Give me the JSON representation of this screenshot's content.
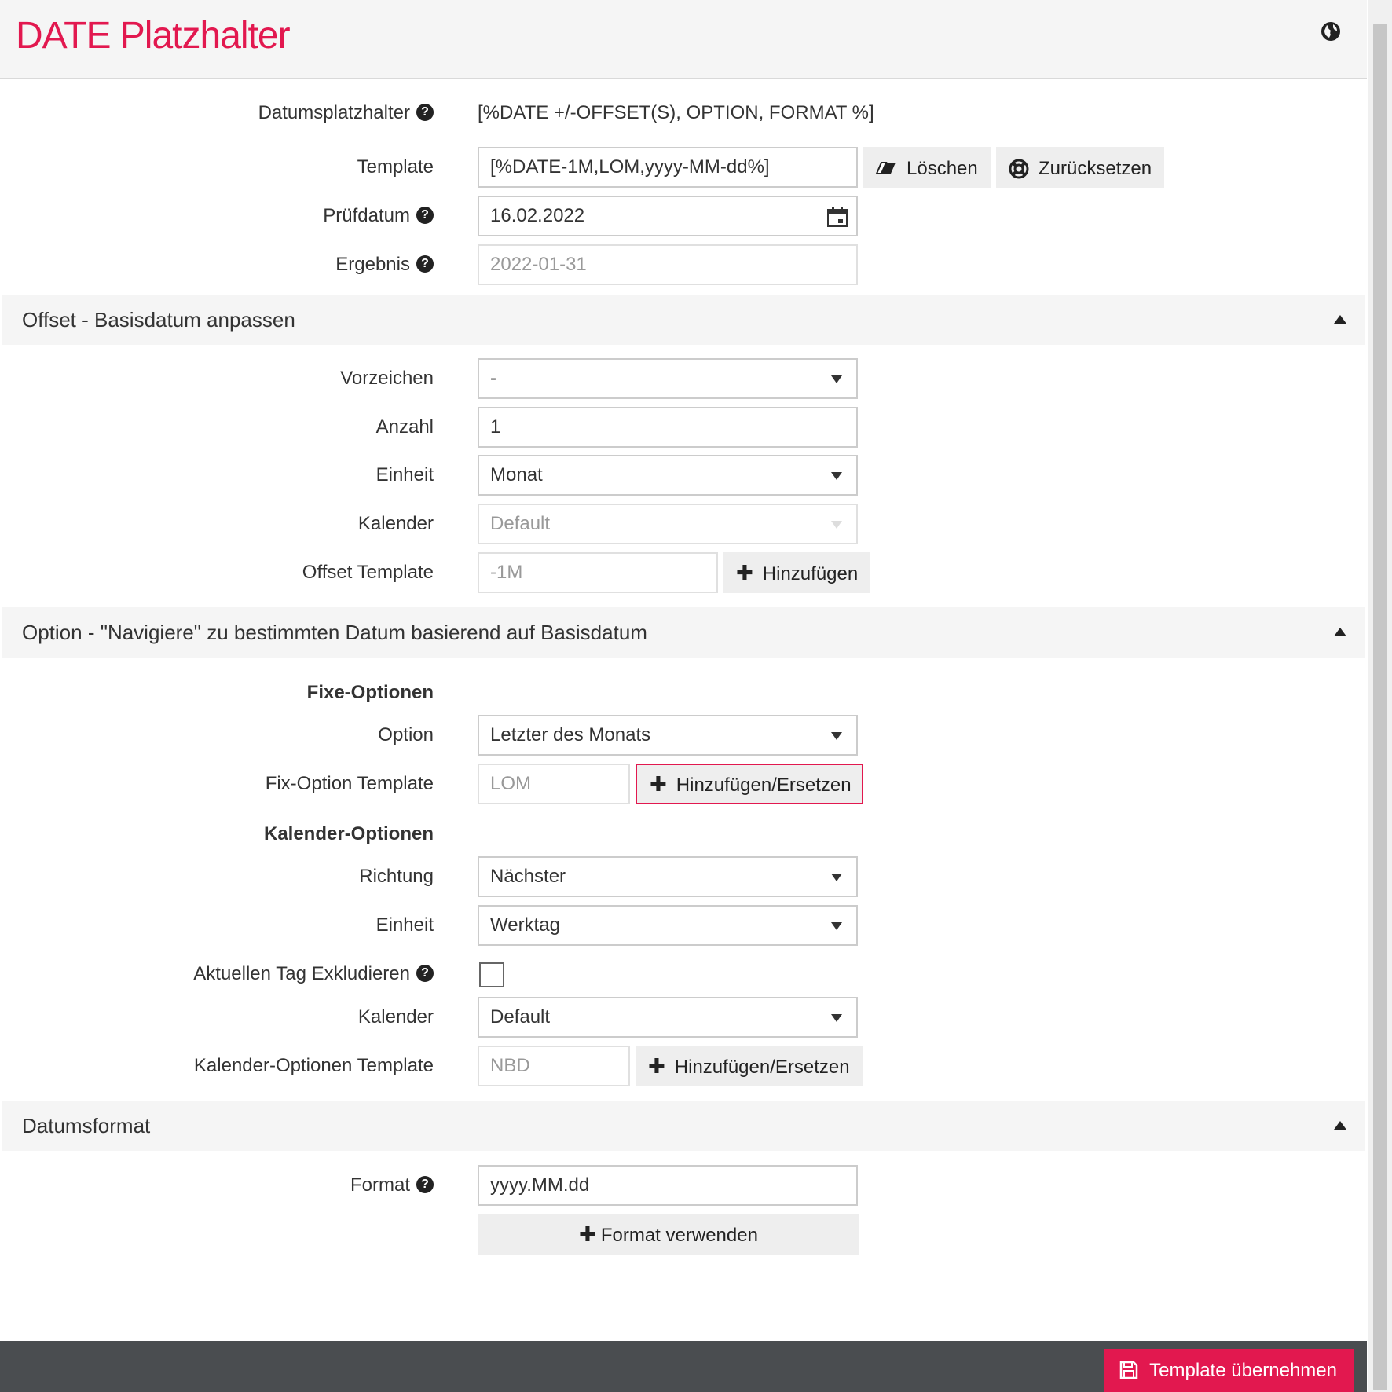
{
  "header": {
    "title": "DATE Platzhalter",
    "globe_icon": "globe-icon"
  },
  "top": {
    "datumsplatzhalter_label": "Datumsplatzhalter",
    "datumsplatzhalter_value": "[%DATE +/-OFFSET(S), OPTION, FORMAT %]",
    "template_label": "Template",
    "template_value": "[%DATE-1M,LOM,yyyy-MM-dd%]",
    "loeschen_label": "Löschen",
    "zuruecksetzen_label": "Zurücksetzen",
    "pruefdatum_label": "Prüfdatum",
    "pruefdatum_value": "16.02.2022",
    "ergebnis_label": "Ergebnis",
    "ergebnis_value": "2022-01-31"
  },
  "offset": {
    "title": "Offset - Basisdatum anpassen",
    "vorzeichen_label": "Vorzeichen",
    "vorzeichen_value": "-",
    "anzahl_label": "Anzahl",
    "anzahl_value": "1",
    "einheit_label": "Einheit",
    "einheit_value": "Monat",
    "kalender_label": "Kalender",
    "kalender_value": "Default",
    "template_label": "Offset Template",
    "template_value": "-1M",
    "add_label": "Hinzufügen"
  },
  "option": {
    "title": "Option - \"Navigiere\" zu bestimmten Datum basierend auf Basisdatum",
    "fixe_heading": "Fixe-Optionen",
    "option_label": "Option",
    "option_value": "Letzter des Monats",
    "fix_template_label": "Fix-Option Template",
    "fix_template_value": "LOM",
    "fix_add_label": "Hinzufügen/Ersetzen",
    "kalender_heading": "Kalender-Optionen",
    "richtung_label": "Richtung",
    "richtung_value": "Nächster",
    "einheit_label": "Einheit",
    "einheit_value": "Werktag",
    "exclude_label": "Aktuellen Tag Exkludieren",
    "kalender_label": "Kalender",
    "kalender_value": "Default",
    "kal_template_label": "Kalender-Optionen Template",
    "kal_template_value": "NBD",
    "kal_add_label": "Hinzufügen/Ersetzen"
  },
  "datumsformat": {
    "title": "Datumsformat",
    "format_label": "Format",
    "format_value": "yyyy.MM.dd",
    "use_label": "Format verwenden"
  },
  "footer": {
    "apply_label": "Template übernehmen"
  },
  "colors": {
    "accent": "#e2184f",
    "footer_bg": "#4a4d50",
    "section_bg": "#f5f5f5"
  }
}
